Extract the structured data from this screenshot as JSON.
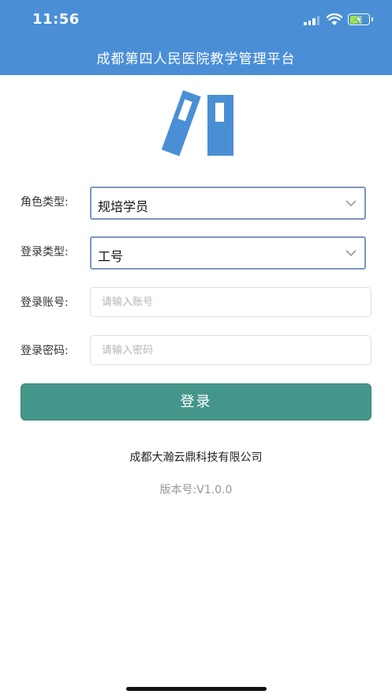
{
  "status_bar": {
    "time": "11:56"
  },
  "header": {
    "title": "成都第四人民医院教学管理平台"
  },
  "logo": {
    "icon": "binders-icon",
    "color": "#4a8fd6"
  },
  "form": {
    "role": {
      "label": "角色类型:",
      "value": "规培学员"
    },
    "login_type": {
      "label": "登录类型:",
      "value": "工号"
    },
    "account": {
      "label": "登录账号:",
      "placeholder": "请输入账号",
      "value": ""
    },
    "password": {
      "label": "登录密码:",
      "placeholder": "请输入密码",
      "value": ""
    }
  },
  "login_button": {
    "label": "登录"
  },
  "footer": {
    "company": "成都大瀚云鼎科技有限公司",
    "version": "版本号:V1.0.0"
  },
  "colors": {
    "header": "#4a8fd6",
    "button": "#45968a",
    "select_border": "#7d95c2"
  }
}
